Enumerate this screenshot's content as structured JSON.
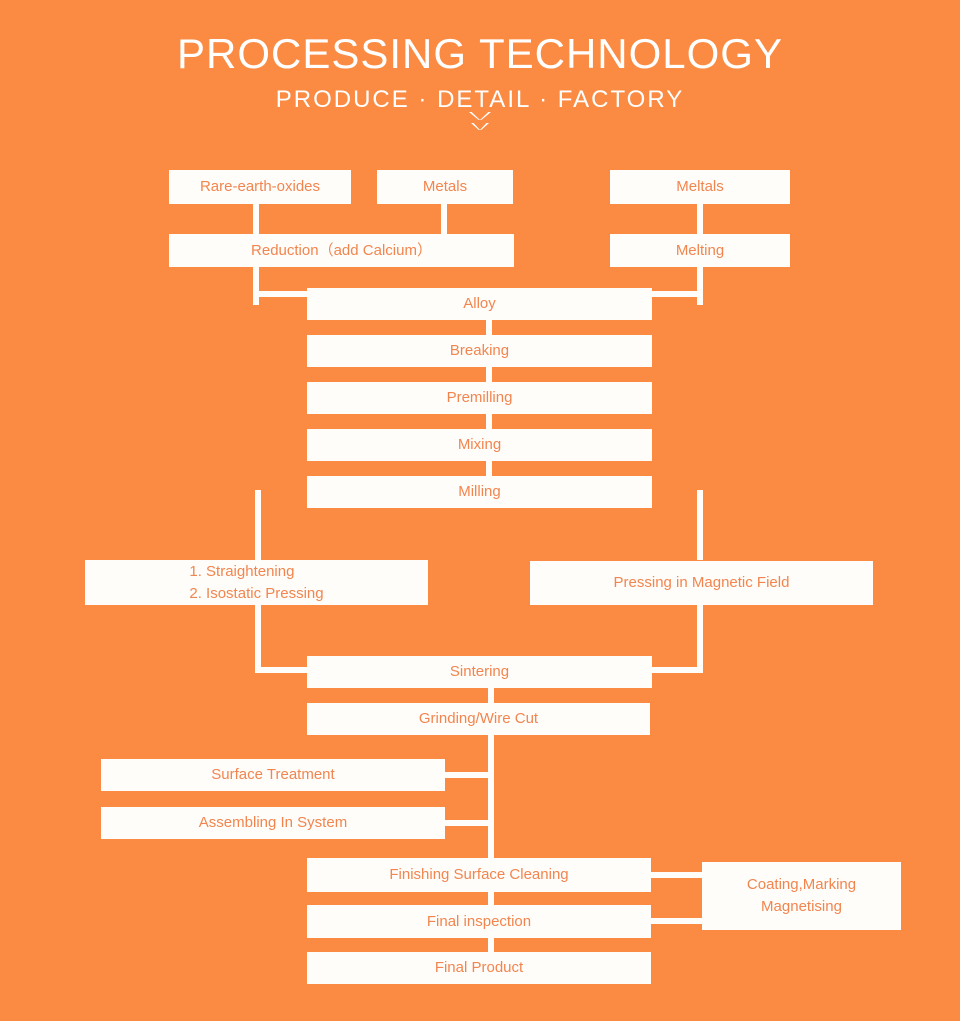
{
  "header": {
    "title": "PROCESSING TECHNOLOGY",
    "subtitle": "PRODUCE · DETAIL · FACTORY",
    "chevron_icon": "double-chevron-down-icon"
  },
  "colors": {
    "background": "#fb8b42",
    "box_fill": "#fffdf9",
    "box_text": "#f2854f",
    "header_text": "#ffffff",
    "connector": "#fffdf9"
  },
  "flowchart": {
    "type": "process-flow-diagram",
    "nodes": [
      {
        "id": "rare-earth-oxides",
        "label": "Rare-earth-oxides"
      },
      {
        "id": "metals",
        "label": "Metals"
      },
      {
        "id": "meltals",
        "label": "Meltals"
      },
      {
        "id": "reduction",
        "label": "Reduction（add Calcium）"
      },
      {
        "id": "melting",
        "label": "Melting"
      },
      {
        "id": "alloy",
        "label": "Alloy"
      },
      {
        "id": "breaking",
        "label": "Breaking"
      },
      {
        "id": "premilling",
        "label": "Premilling"
      },
      {
        "id": "mixing",
        "label": "Mixing"
      },
      {
        "id": "milling",
        "label": "Milling"
      },
      {
        "id": "straightening",
        "label_line1": "1. Straightening",
        "label_line2": "2. Isostatic Pressing"
      },
      {
        "id": "pressing-magnetic",
        "label": "Pressing in Magnetic Field"
      },
      {
        "id": "sintering",
        "label": "Sintering"
      },
      {
        "id": "grinding-wire-cut",
        "label": "Grinding/Wire Cut"
      },
      {
        "id": "surface-treatment",
        "label": "Surface Treatment"
      },
      {
        "id": "assembling-in-system",
        "label": "Assembling In System"
      },
      {
        "id": "finishing-surface-cleaning",
        "label": "Finishing Surface Cleaning"
      },
      {
        "id": "final-inspection",
        "label": "Final inspection"
      },
      {
        "id": "final-product",
        "label": "Final Product"
      },
      {
        "id": "coating-marking",
        "label_line1": "Coating,Marking",
        "label_line2": "Magnetising"
      }
    ]
  }
}
